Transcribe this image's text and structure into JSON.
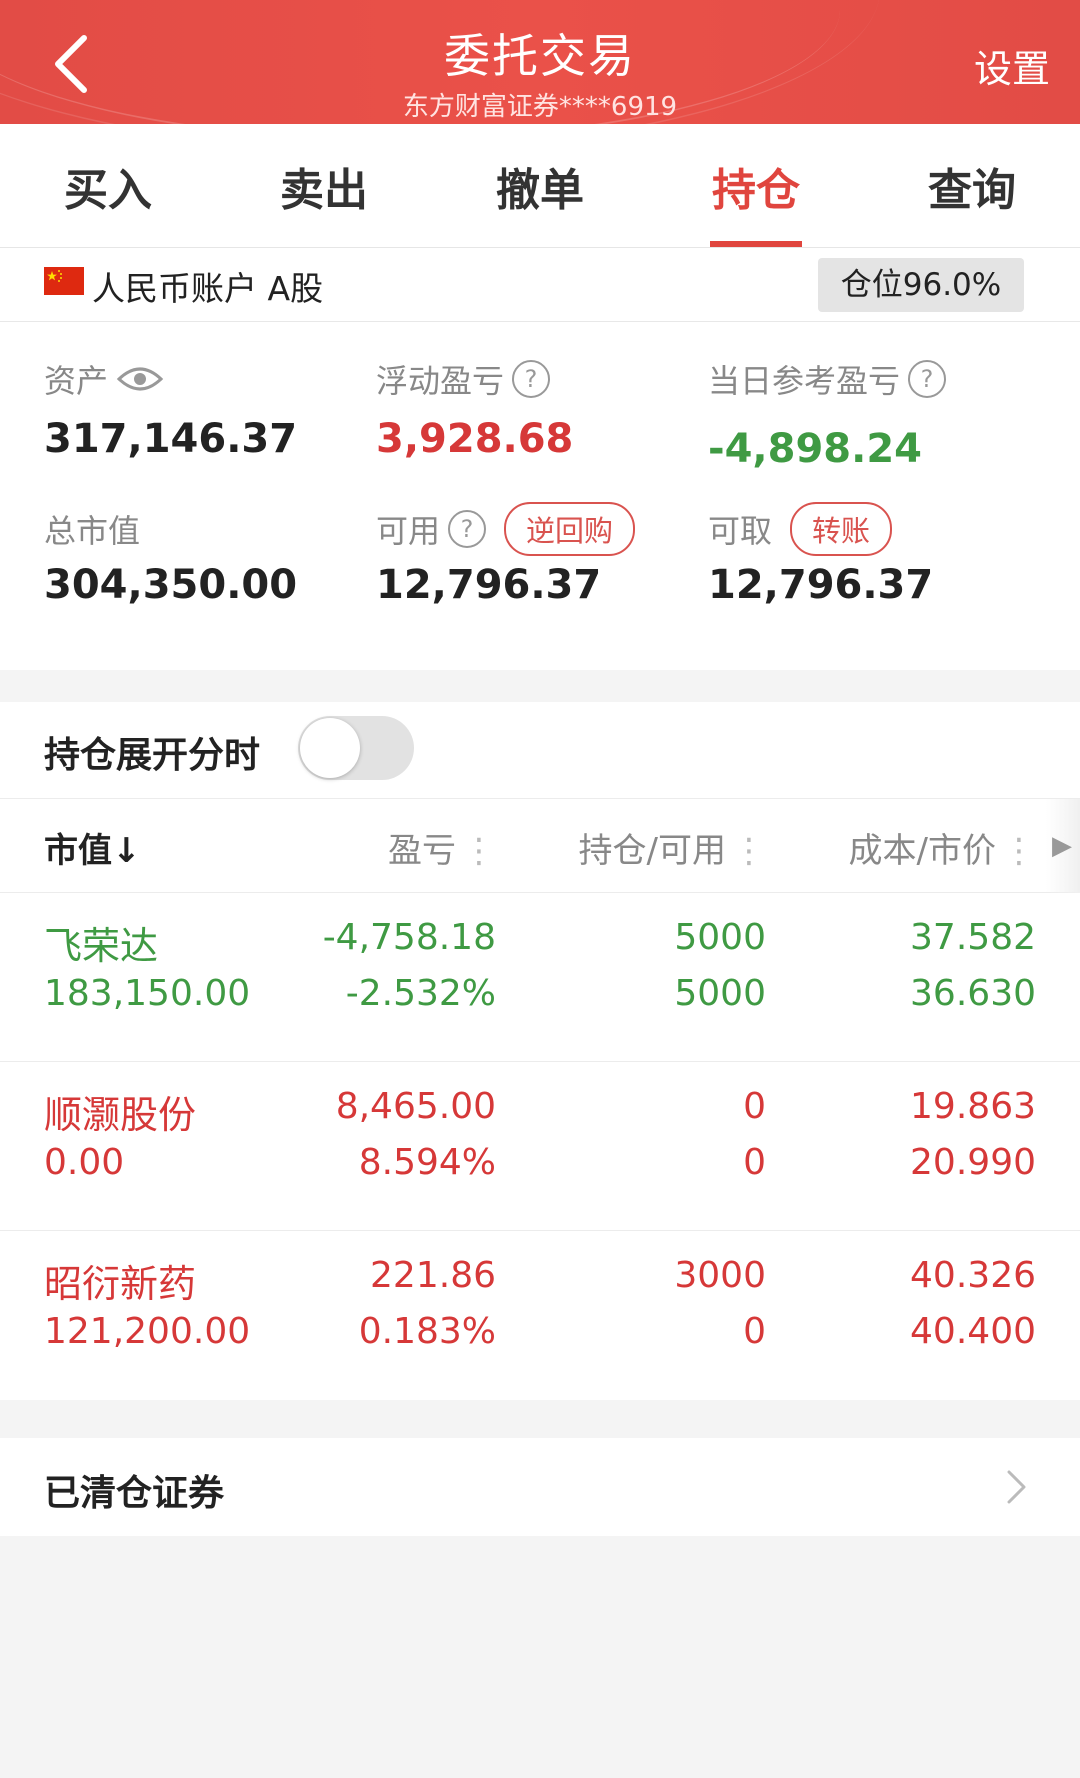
{
  "header": {
    "title": "委托交易",
    "subtitle": "东方财富证券****6919",
    "settings_label": "设置"
  },
  "tabs": [
    {
      "label": "买入",
      "active": false
    },
    {
      "label": "卖出",
      "active": false
    },
    {
      "label": "撤单",
      "active": false
    },
    {
      "label": "持仓",
      "active": true
    },
    {
      "label": "查询",
      "active": false
    }
  ],
  "account": {
    "label": "人民币账户 A股",
    "position_ratio": "仓位96.0%",
    "flag_icon": "china-flag-icon"
  },
  "summary": {
    "assets": {
      "label": "资产",
      "value": "317,146.37"
    },
    "floating_pnl": {
      "label": "浮动盈亏",
      "value": "3,928.68"
    },
    "daily_pnl": {
      "label": "当日参考盈亏",
      "value": "-4,898.24"
    },
    "market_value": {
      "label": "总市值",
      "value": "304,350.00"
    },
    "available": {
      "label": "可用",
      "value": "12,796.37",
      "action": "逆回购"
    },
    "withdrawable": {
      "label": "可取",
      "value": "12,796.37",
      "action": "转账"
    }
  },
  "toggle": {
    "label": "持仓展开分时",
    "on": false
  },
  "table": {
    "headers": [
      "市值↓",
      "盈亏",
      "持仓/可用",
      "成本/市价"
    ],
    "rows": [
      {
        "name": "飞荣达",
        "market_value": "183,150.00",
        "pnl": "-4,758.18",
        "pnl_pct": "-2.532%",
        "holding": "5000",
        "available": "5000",
        "cost": "37.582",
        "price": "36.630",
        "color": "green"
      },
      {
        "name": "顺灏股份",
        "market_value": "0.00",
        "pnl": "8,465.00",
        "pnl_pct": "8.594%",
        "holding": "0",
        "available": "0",
        "cost": "19.863",
        "price": "20.990",
        "color": "red"
      },
      {
        "name": "昭衍新药",
        "market_value": "121,200.00",
        "pnl": "221.86",
        "pnl_pct": "0.183%",
        "holding": "3000",
        "available": "0",
        "cost": "40.326",
        "price": "40.400",
        "color": "red"
      }
    ]
  },
  "cleared": {
    "label": "已清仓证券"
  },
  "colors": {
    "accent": "#e0453e",
    "gain": "#d63838",
    "loss": "#3f9a43"
  }
}
